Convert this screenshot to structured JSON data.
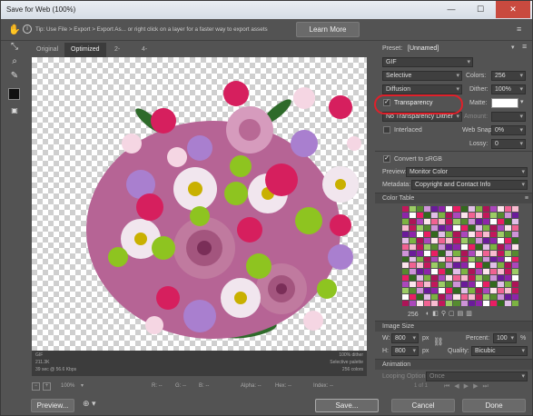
{
  "window": {
    "title": "Save for Web (100%)"
  },
  "tipbar": {
    "tip": "Tip: Use File > Export > Export As... or right click on a layer for a faster way to export assets",
    "learn_more": "Learn More"
  },
  "tabs": [
    {
      "label": "Original"
    },
    {
      "label": "Optimized"
    },
    {
      "label": "2-Up"
    },
    {
      "label": "4-Up"
    }
  ],
  "info": {
    "format": "GIF",
    "size": "211.3K",
    "time": "39 sec @ 56.6 Kbps",
    "dither": "100% dither",
    "palette": "Selective palette",
    "colors": "256 colors"
  },
  "status": {
    "zoom": "100%",
    "r": "R: --",
    "g": "G: --",
    "b": "B: --",
    "alpha": "Alpha: --",
    "hex": "Hex: --",
    "index": "Index: --"
  },
  "panel": {
    "preset_label": "Preset:",
    "preset_value": "[Unnamed]",
    "format": "GIF",
    "reduction": "Selective",
    "colors_label": "Colors:",
    "colors_value": "256",
    "dither_algo": "Diffusion",
    "dither_label": "Dither:",
    "dither_value": "100%",
    "transparency": "Transparency",
    "matte_label": "Matte:",
    "transparency_dither": "No Transparency Dither",
    "amount_label": "Amount:",
    "interlaced": "Interlaced",
    "websnap_label": "Web Snap:",
    "websnap_value": "0%",
    "lossy_label": "Lossy:",
    "lossy_value": "0",
    "convert_srgb": "Convert to sRGB",
    "preview_label": "Preview:",
    "preview_value": "Monitor Color",
    "metadata_label": "Metadata:",
    "metadata_value": "Copyright and Contact Info",
    "color_table": "Color Table",
    "color_count": "256",
    "image_size": "Image Size",
    "w_label": "W:",
    "w_value": "800",
    "h_label": "H:",
    "h_value": "800",
    "px": "px",
    "percent_label": "Percent:",
    "percent_value": "100",
    "pct": "%",
    "quality_label": "Quality:",
    "quality_value": "Bicubic",
    "animation": "Animation",
    "looping_label": "Looping Options:",
    "looping_value": "Once",
    "frame_counter": "1 of 1"
  },
  "bottom": {
    "preview": "Preview...",
    "save": "Save...",
    "cancel": "Cancel",
    "done": "Done"
  },
  "colors": {
    "accent_highlight": "#e0202a",
    "panel_bg": "#535353"
  }
}
